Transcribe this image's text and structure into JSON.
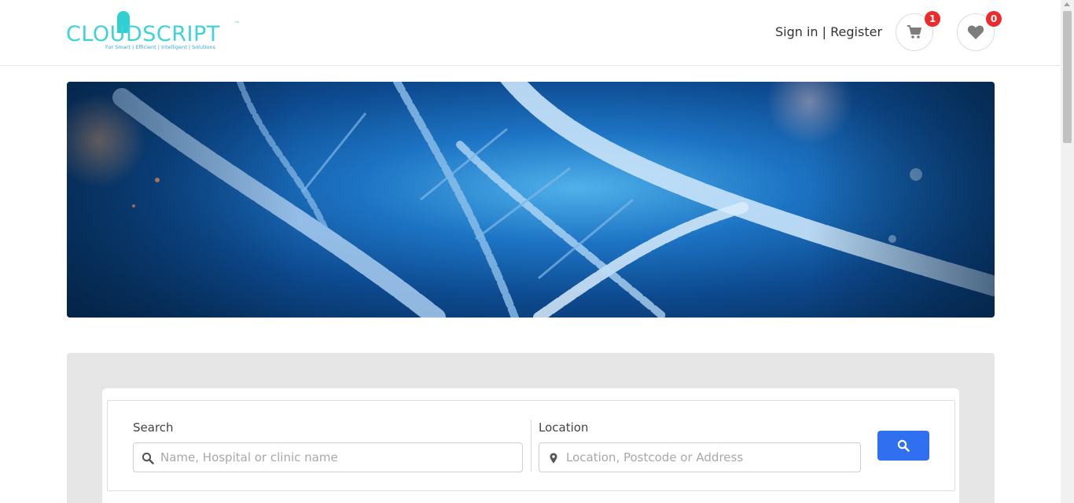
{
  "brand": {
    "name": "CLOUDSCRIPT",
    "trademark": "™",
    "tagline": "For Smart | Efficient | Intelligent | Solutions",
    "color": "#3ed3d9"
  },
  "header": {
    "sign_in": "Sign in",
    "separator": " | ",
    "register": "Register",
    "cart": {
      "icon": "cart-icon",
      "count": "1"
    },
    "wishlist": {
      "icon": "heart-icon",
      "count": "0"
    }
  },
  "banner": {
    "description_icon": "dna-helix-image"
  },
  "search": {
    "search_label": "Search",
    "search_placeholder": "Name, Hospital or clinic name",
    "location_label": "Location",
    "location_placeholder": "Location, Postcode or Address",
    "button_icon": "search-icon"
  },
  "colors": {
    "accent": "#2f6ff0",
    "badge": "#ee2b2b"
  }
}
